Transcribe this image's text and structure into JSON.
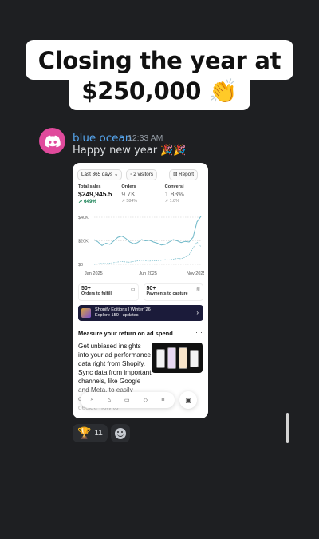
{
  "caption": {
    "line1": "Closing the year at",
    "line2": "$250,000 👏"
  },
  "message": {
    "username": "blue ocean",
    "timestamp": "12:33 AM",
    "text": "Happy new year",
    "emoji": "🎉🎉",
    "username_color": "#56a6f0",
    "avatar_color": "#e04a9c"
  },
  "app": {
    "toolbar": {
      "range": "Last 365 days ⌄",
      "visitors": "◦ 2 visitors",
      "report": "⊞ Report"
    },
    "metrics": [
      {
        "label": "Total sales",
        "value": "$249,945.5",
        "change": "↗ 649%"
      },
      {
        "label": "Orders",
        "value": "9.7K",
        "change": "↗ 584%"
      },
      {
        "label": "Conversi",
        "value": "1.83%",
        "change": "↗ 1.8%"
      }
    ],
    "chart": {
      "y_ticks": [
        "$40K",
        "$20K",
        "$0"
      ],
      "x_ticks": [
        "Jan 2025",
        "Jun 2025",
        "Nov 2025"
      ]
    },
    "cards": [
      {
        "count": "50+",
        "label": "Orders to fulfill",
        "icon": "inbox-icon"
      },
      {
        "count": "50+",
        "label": "Payments to capture",
        "icon": "card-icon"
      }
    ],
    "banner": {
      "line1": "Shopify Editions | Winter '26",
      "line2": "Explore 150+ updates",
      "color": "#1b1b3a"
    },
    "section_title": "Measure your return on ad spend",
    "more": "···",
    "body": "Get unbiased insights into your ad performance data right from Shopify. Sync data from important channels, like Google and Meta, to easily compare metrics and decide how to",
    "tabs": [
      {
        "icon": "search-icon",
        "glyph": "⌕"
      },
      {
        "icon": "home-icon",
        "glyph": "⌂"
      },
      {
        "icon": "orders-icon",
        "glyph": "▭"
      },
      {
        "icon": "tag-icon",
        "glyph": "◇"
      },
      {
        "icon": "menu-icon",
        "glyph": "≡"
      }
    ],
    "store_glyph": "▣"
  },
  "reactions": [
    {
      "emoji": "🏆",
      "count": "11"
    }
  ],
  "chart_data": {
    "type": "line",
    "x": [
      "Jan 2025",
      "Jun 2025",
      "Nov 2025"
    ],
    "ylim": [
      0,
      40000
    ],
    "y_ticks": [
      "$0",
      "$20K",
      "$40K"
    ],
    "series": [
      {
        "values": [
          21000,
          19000,
          16000,
          18000,
          17000,
          20000,
          23000,
          24000,
          22000,
          19000,
          17500,
          18500,
          21000,
          20000,
          20500,
          19000,
          18000,
          16500,
          17000,
          19000,
          21000,
          20000,
          18500,
          19500,
          19000,
          23000,
          36000,
          48000
        ]
      },
      {
        "values": [
          0,
          500,
          800,
          600,
          1000,
          1500,
          2000,
          2500,
          2000,
          1800,
          2500,
          3000,
          3500,
          3000,
          2800,
          3200,
          3000,
          3500,
          4000,
          3800,
          4500,
          5000,
          4800,
          6000,
          8000,
          14000,
          19000,
          15000
        ]
      }
    ]
  }
}
